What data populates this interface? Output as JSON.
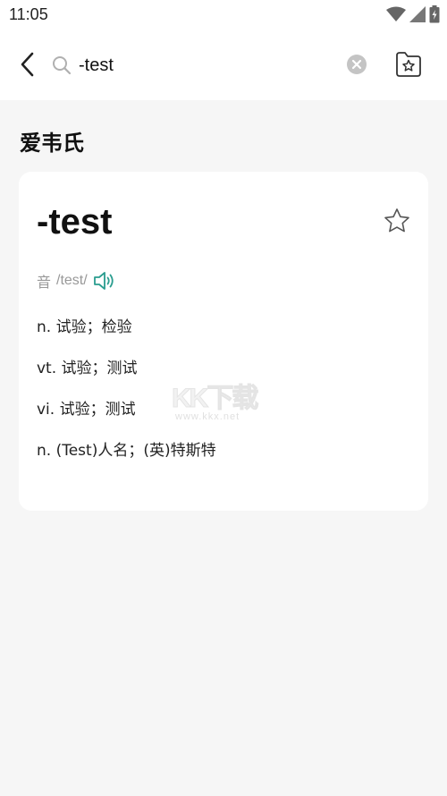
{
  "status_bar": {
    "time": "11:05",
    "icons": [
      "wifi-icon",
      "signal-icon",
      "battery-icon"
    ]
  },
  "search": {
    "query": "-test",
    "icons": [
      "back-arrow-icon",
      "search-icon",
      "clear-icon",
      "wordbook-icon"
    ]
  },
  "dictionary": {
    "name": "爱韦氏"
  },
  "entry": {
    "word": "-test",
    "phonetic_label": "音",
    "phonetic": "/test/",
    "definitions": [
      "n. 试验；检验",
      "vt. 试验；测试",
      "vi. 试验；测试",
      "n. (Test)人名；(英)特斯特"
    ],
    "icons": [
      "star-icon",
      "speaker-icon"
    ]
  },
  "watermark": {
    "main": "KK下载",
    "sub": "www.kkx.net"
  },
  "colors": {
    "accent_teal": "#2a9d8f",
    "background": "#f6f6f6",
    "card": "#ffffff",
    "muted_text": "#999999"
  }
}
